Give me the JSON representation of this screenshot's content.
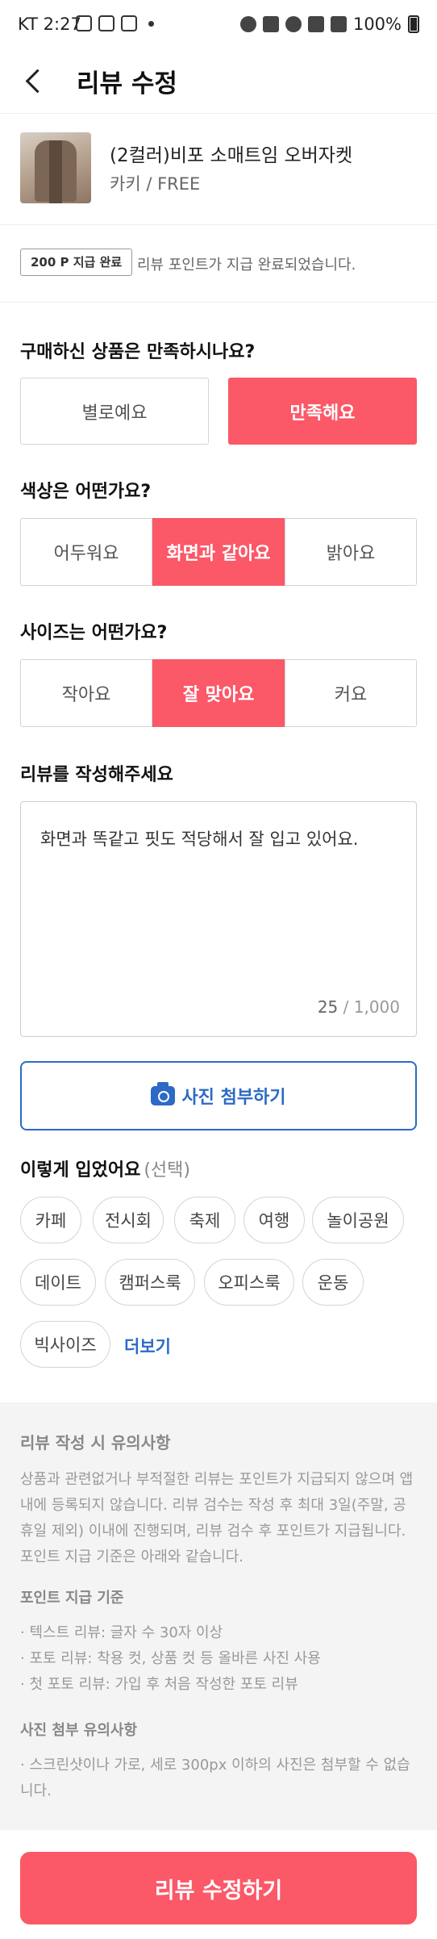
{
  "status_bar": {
    "carrier": "KT 2:27",
    "battery": "100%"
  },
  "header": {
    "title": "리뷰 수정"
  },
  "product": {
    "name": "(2컬러)비포 소매트임 오버자켓",
    "option": "카키 / FREE"
  },
  "points": {
    "badge": "200 P 지급 완료",
    "message": "리뷰 포인트가 지급 완료되었습니다."
  },
  "satisfaction": {
    "question": "구매하신 상품은 만족하시나요?",
    "options": [
      "별로예요",
      "만족해요"
    ],
    "selected": "만족해요"
  },
  "color": {
    "question": "색상은 어떤가요?",
    "options": [
      "어두워요",
      "화면과 같아요",
      "밝아요"
    ],
    "selected": "화면과 같아요"
  },
  "size": {
    "question": "사이즈는 어떤가요?",
    "options": [
      "작아요",
      "잘 맞아요",
      "커요"
    ],
    "selected": "잘 맞아요"
  },
  "review": {
    "label": "리뷰를 작성해주세요",
    "text": "화면과 똑같고 핏도 적당해서 잘 입고 있어요.",
    "count": "25",
    "max": "/ 1,000"
  },
  "photo_button": {
    "label": "사진 첨부하기"
  },
  "wear": {
    "label": "이렇게 입었어요",
    "sub": "(선택)",
    "tags": [
      "카페",
      "전시회",
      "축제",
      "여행",
      "놀이공원",
      "데이트",
      "캠퍼스룩",
      "오피스룩",
      "운동",
      "빅사이즈"
    ],
    "more": "더보기"
  },
  "notice": {
    "title": "리뷰 작성 시 유의사항",
    "body": "상품과 관련없거나 부적절한 리뷰는 포인트가 지급되지 않으며 앱 내에 등록되지 않습니다. 리뷰 검수는 작성 후 최대 3일(주말, 공휴일 제외) 이내에 진행되며, 리뷰 검수 후 포인트가 지급됩니다. 포인트 지급 기준은 아래와 같습니다.",
    "criteria_title": "포인트 지급 기준",
    "criteria": [
      "· 텍스트 리뷰: 글자 수 30자 이상",
      "· 포토 리뷰: 착용 컷, 상품 컷 등 올바른 사진 사용",
      "· 첫 포토 리뷰: 가입 후 처음 작성한 포토 리뷰"
    ],
    "photo_title": "사진 첨부 유의사항",
    "photo_text": "· 스크린샷이나 가로, 세로 300px 이하의 사진은 첨부할 수 없습니다."
  },
  "submit": {
    "label": "리뷰 수정하기"
  },
  "colors": {
    "accent": "#fb5868",
    "link": "#2c6ac6"
  },
  "icons": {
    "back": "chevron-left-icon",
    "camera": "camera-icon"
  }
}
